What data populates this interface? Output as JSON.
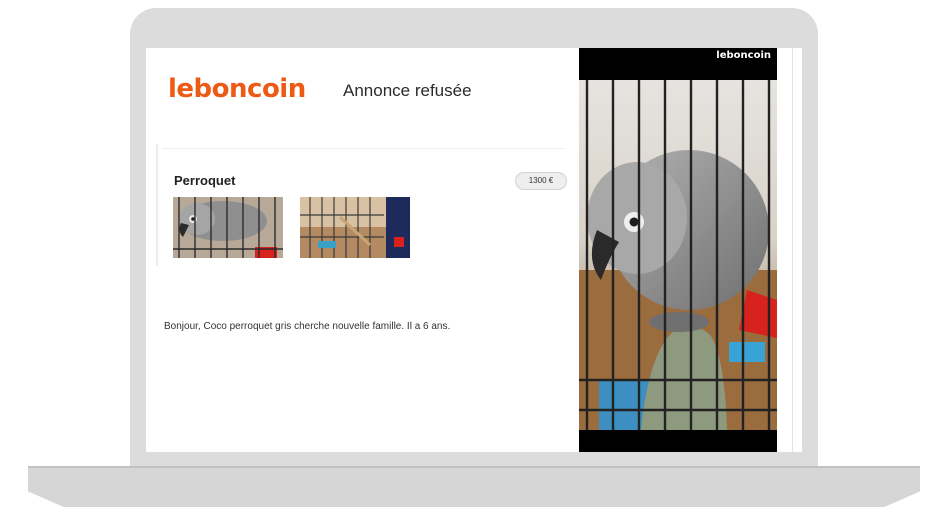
{
  "brand": "leboncoin",
  "email": {
    "title": "Annonce refusée",
    "listing": {
      "title": "Perroquet",
      "price": "1300 €",
      "thumbnails": [
        "parrot-photo",
        "cage-photo"
      ]
    },
    "message": "Bonjour, Coco perroquet gris cherche nouvelle famille. Il a 6 ans."
  },
  "photo_panel": {
    "brand": "leboncoin",
    "image": "african-grey-parrot-on-perch"
  },
  "colors": {
    "brand_orange": "#ec5a13",
    "parrot_tail_red": "#d8221e",
    "frame_grey": "#dcdcdc"
  }
}
